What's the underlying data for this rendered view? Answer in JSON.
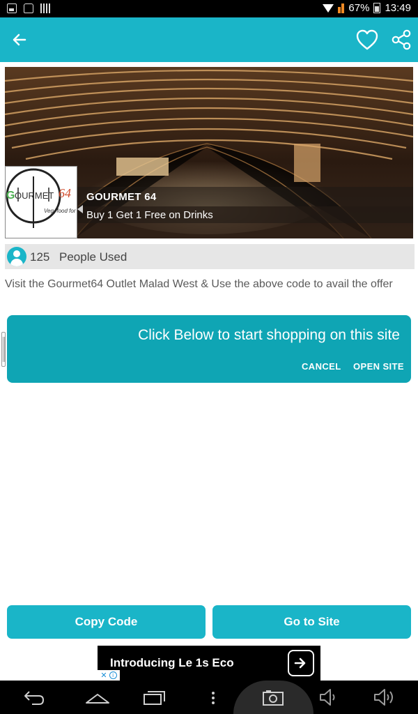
{
  "status_bar": {
    "battery": "67%",
    "time": "13:49"
  },
  "app_bar": {
    "icons": [
      "back-arrow-icon",
      "heart-icon",
      "share-icon"
    ]
  },
  "banner": {
    "title": "GOURMET 64",
    "subtitle": "Buy 1 Get 1 Free on Drinks",
    "logo": {
      "name": "GOURMET 64",
      "tagline": "Veg. food for l"
    }
  },
  "usage": {
    "count": "125",
    "label": "People Used"
  },
  "description": "Visit the Gourmet64 Outlet Malad West & Use the above code to avail the offer",
  "dialog": {
    "message": "Click Below to start shopping on this site",
    "cancel_label": "CANCEL",
    "open_label": "OPEN SITE"
  },
  "actions": {
    "copy_label": "Copy Code",
    "go_label": "Go to Site"
  },
  "ad": {
    "text": "Introducing Le 1s Eco"
  },
  "colors": {
    "primary": "#1ab5c8",
    "dialog": "#0fa5b4",
    "status_bar": "#000000"
  }
}
